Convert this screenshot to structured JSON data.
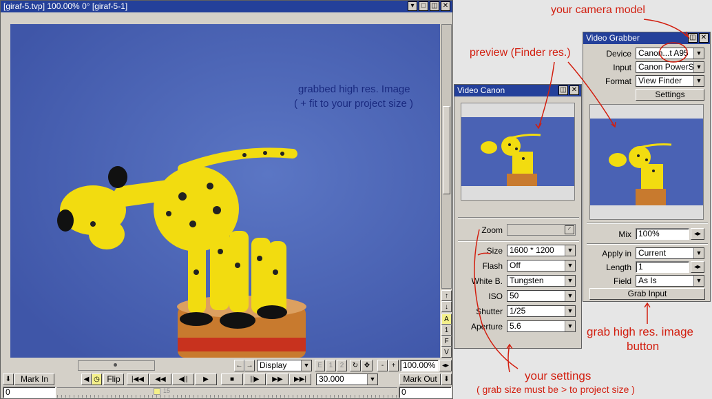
{
  "main_window": {
    "title": "[giraf-5.tvp]  100.00%   0°   [giraf-5-1]",
    "canvas_text_line1": "grabbed high res. Image",
    "canvas_text_line2": "( + fit to your project size )",
    "side_tools": [
      "↑",
      "↓",
      "A",
      "1",
      "F",
      "V"
    ],
    "toolbar1": {
      "display_label": "Display",
      "zoom_value": "100.00%",
      "frame_buttons": [
        "E",
        "1",
        "2"
      ]
    },
    "toolbar2": {
      "mark_in": "Mark In",
      "flip": "Flip",
      "fps": "30.000",
      "mark_out": "Mark Out"
    },
    "timeline": {
      "in_value": "0",
      "out_value": "0",
      "frame_marker": "15"
    }
  },
  "video_canon": {
    "title": "Video Canon",
    "zoom_label": "Zoom",
    "fields": [
      {
        "label": "Size",
        "value": "1600 * 1200"
      },
      {
        "label": "Flash",
        "value": "Off"
      },
      {
        "label": "White B.",
        "value": "Tungsten"
      },
      {
        "label": "ISO",
        "value": "50"
      },
      {
        "label": "Shutter",
        "value": "1/25"
      },
      {
        "label": "Aperture",
        "value": "5.6"
      }
    ]
  },
  "video_grabber": {
    "title": "Video Grabber",
    "device_label": "Device",
    "device_value": "Canon...t A95",
    "input_label": "Input",
    "input_value": "Canon PowerSho",
    "format_label": "Format",
    "format_value": "View Finder",
    "settings_button": "Settings",
    "mix_label": "Mix",
    "mix_value": "100%",
    "apply_label": "Apply in",
    "apply_value": "Current",
    "length_label": "Length",
    "length_value": "1",
    "field_label": "Field",
    "field_value": "As Is",
    "grab_button": "Grab Input"
  },
  "annotations": {
    "camera_model": "your camera model",
    "preview": "preview (Finder res.)",
    "grab_line1": "grab high res. image",
    "grab_line2": "button",
    "settings_line1": "your settings",
    "settings_line2": "( grab size must be > to project size )"
  },
  "colors": {
    "titlebar": "#24409a",
    "canvas": "#4a62b4",
    "annotation": "#d21e0f",
    "toy": "#f2dc10"
  }
}
